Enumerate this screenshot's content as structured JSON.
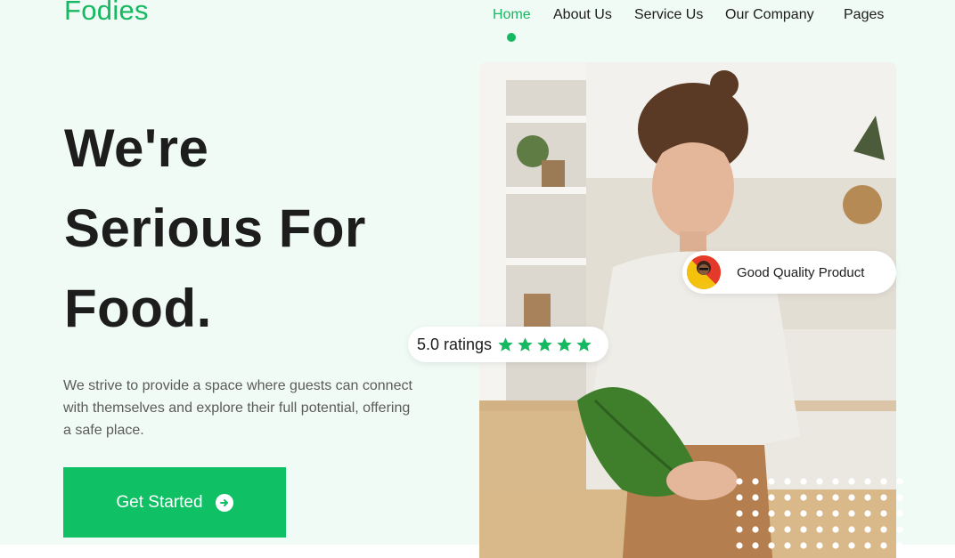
{
  "brand": {
    "name": "Fodies",
    "accent_color": "#16b862"
  },
  "nav": {
    "items": [
      {
        "label": "Home",
        "active": true
      },
      {
        "label": "About Us",
        "active": false
      },
      {
        "label": "Service Us",
        "active": false
      },
      {
        "label": "Our Company",
        "active": false
      },
      {
        "label": "Pages",
        "active": false
      }
    ]
  },
  "hero": {
    "title_lines": [
      "We're",
      "Serious For",
      "Food."
    ],
    "description": "We strive to provide a space where guests can connect with themselves and explore their full potential, offering a safe place.",
    "cta_label": "Get Started",
    "cta_icon": "arrow-circle-right-icon"
  },
  "badges": {
    "rating_text": "5.0 ratings",
    "rating_stars": 5,
    "quality_text": "Good Quality Product"
  },
  "colors": {
    "page_background": "#f1fbf5",
    "cta_background": "#10c064",
    "star": "#16b862"
  }
}
